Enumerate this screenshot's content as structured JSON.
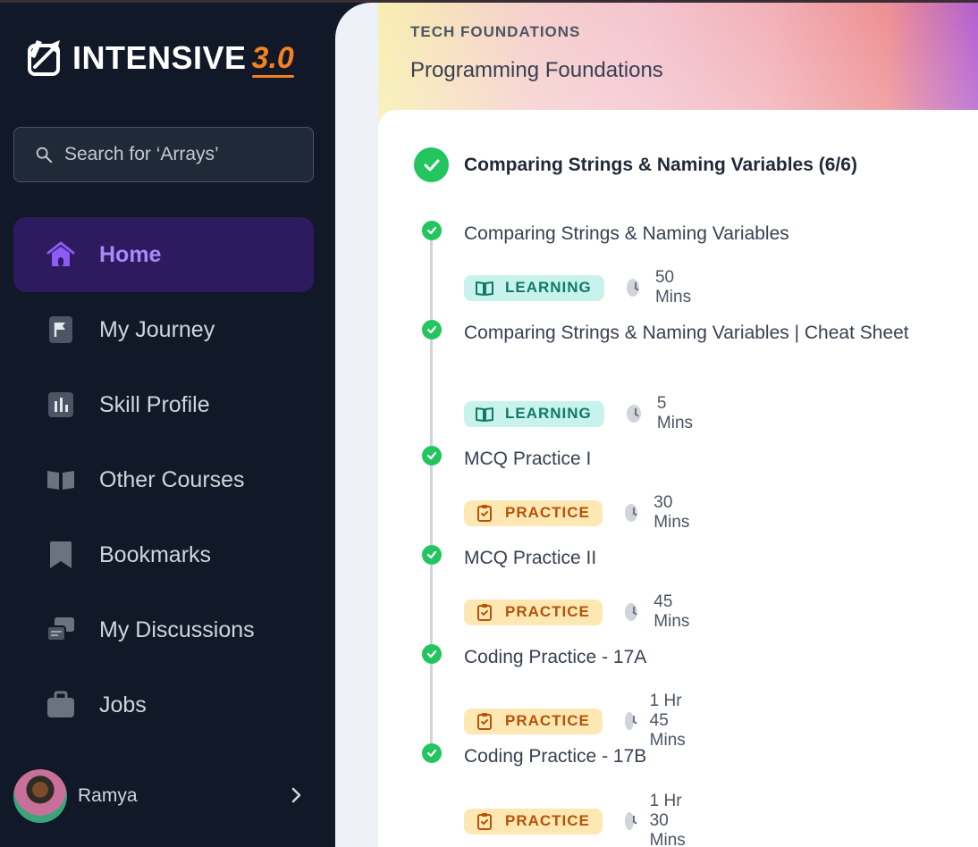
{
  "sidebar": {
    "logo": {
      "text": "INTENSIVE",
      "version": "3.0"
    },
    "search": {
      "placeholder": "Search for ‘Arrays’"
    },
    "items": [
      {
        "label": "Home",
        "icon": "home-icon",
        "active": true
      },
      {
        "label": "My Journey",
        "icon": "flag-icon"
      },
      {
        "label": "Skill Profile",
        "icon": "bar-chart-icon"
      },
      {
        "label": "Other Courses",
        "icon": "open-book-icon"
      },
      {
        "label": "Bookmarks",
        "icon": "bookmark-icon"
      },
      {
        "label": "My Discussions",
        "icon": "chat-icon"
      },
      {
        "label": "Jobs",
        "icon": "briefcase-icon"
      }
    ],
    "profile": {
      "name": "Ramya"
    }
  },
  "header": {
    "kicker": "TECH FOUNDATIONS",
    "title": "Programming Foundations"
  },
  "module": {
    "title": "Comparing Strings & Naming Variables (6/6)",
    "items": [
      {
        "title": "Comparing Strings & Naming Variables",
        "type": "LEARNING",
        "duration": "50 Mins"
      },
      {
        "title": "Comparing Strings & Naming Variables | Cheat Sheet",
        "type": "LEARNING",
        "duration": "5 Mins"
      },
      {
        "title": "MCQ Practice I",
        "type": "PRACTICE",
        "duration": "30 Mins"
      },
      {
        "title": "MCQ Practice II",
        "type": "PRACTICE",
        "duration": "45 Mins"
      },
      {
        "title": "Coding Practice - 17A",
        "type": "PRACTICE",
        "duration": "1 Hr 45 Mins"
      },
      {
        "title": "Coding Practice - 17B",
        "type": "PRACTICE",
        "duration": "1 Hr 30 Mins"
      }
    ]
  },
  "colors": {
    "sidebar_bg": "#111827",
    "active_bg": "#2e1a5f",
    "active_text": "#a78bfa",
    "success": "#22c55e",
    "learning_bg": "#c8f3ec",
    "learning_text": "#0f7a66",
    "practice_bg": "#fde8b3",
    "practice_text": "#b45309",
    "logo_accent": "#f58220"
  }
}
